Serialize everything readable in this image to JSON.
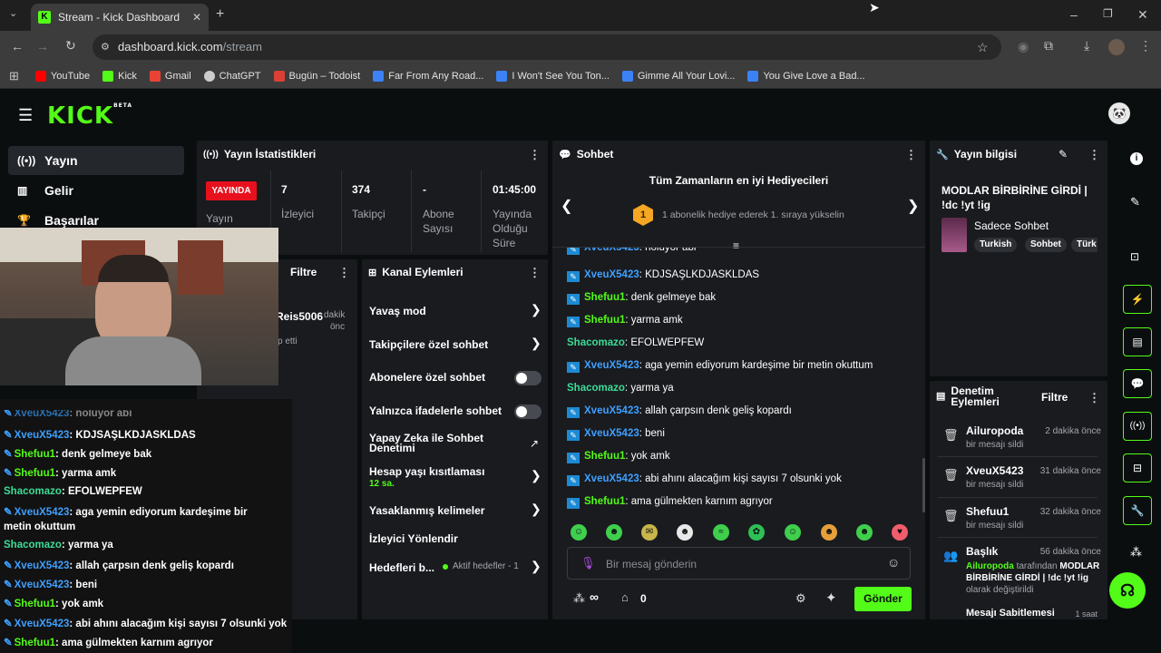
{
  "browser": {
    "tab_title": "Stream - Kick Dashboard",
    "url_domain": "dashboard.kick.com",
    "url_path": "/stream",
    "bookmarks": [
      {
        "label": "YouTube",
        "color": "#ff0000"
      },
      {
        "label": "Kick",
        "color": "#53fc18"
      },
      {
        "label": "Gmail",
        "color": "#ea4335"
      },
      {
        "label": "ChatGPT",
        "color": "#cccccc"
      },
      {
        "label": "Bugün – Todoist",
        "color": "#db4035"
      },
      {
        "label": "Far From Any Road...",
        "color": "#3b82f6"
      },
      {
        "label": "I Won't See You Ton...",
        "color": "#3b82f6"
      },
      {
        "label": "Gimme All Your Lovi...",
        "color": "#3b82f6"
      },
      {
        "label": "You Give Love a Bad...",
        "color": "#3b82f6"
      }
    ]
  },
  "brand": {
    "logo": "KICK",
    "beta": "BETA",
    "accent": "#53fc18"
  },
  "nav": {
    "items": [
      {
        "label": "Yayın",
        "icon": "broadcast-icon"
      },
      {
        "label": "Gelir",
        "icon": "chart-icon"
      },
      {
        "label": "Başarılar",
        "icon": "trophy-icon"
      }
    ]
  },
  "stats": {
    "title": "Yayın İstatistikleri",
    "live_badge": "YAYINDA",
    "live_label": "Yayın",
    "viewers_value": "7",
    "viewers_label": "İzleyici",
    "followers_value": "374",
    "followers_label": "Takipçi",
    "subs_value": "-",
    "subs_label": "Abone Sayısı",
    "duration_value": "01:45:00",
    "duration_label": "Yayında Olduğu Süre"
  },
  "activity": {
    "filter": "Filtre",
    "item_name": "Reis5006",
    "item_time1": "dakik",
    "item_time2": "önc",
    "item_sub": "p etti"
  },
  "channel_actions": {
    "title": "Kanal Eylemleri",
    "slow_mode": "Yavaş mod",
    "followers_only": "Takipçilere özel sohbet",
    "subs_only": "Abonelere özel sohbet",
    "emotes_only": "Yalnızca ifadelerle sohbet",
    "ai_moderation": "Yapay Zeka ile Sohbet Denetimi",
    "account_age": "Hesap yaşı kısıtlaması",
    "account_age_value": "12 sa.",
    "banned_words": "Yasaklanmış kelimeler",
    "redirect": "İzleyici Yönlendir",
    "goals": "Hedefleri b...",
    "goals_status": "Aktif hedefler - 1"
  },
  "chat": {
    "title": "Sohbet",
    "gifters_title": "Tüm Zamanların en iyi Hediyecileri",
    "gifters_rank": "1",
    "gifters_text": "1 abonelik hediye ederek 1. sıraya yükselin",
    "partial_msg": "noluyor abi",
    "messages": [
      {
        "user": "XveuX5423",
        "text": "KDJSAŞLKDJASKLDAS",
        "color": "blue",
        "badge": true
      },
      {
        "user": "Shefuu1",
        "text": "denk gelmeye bak",
        "color": "green",
        "badge": true
      },
      {
        "user": "Shefuu1",
        "text": "yarma amk",
        "color": "green",
        "badge": true
      },
      {
        "user": "Shacomazo",
        "text": "EFOLWEPFEW",
        "color": "teal",
        "badge": false
      },
      {
        "user": "XveuX5423",
        "text": "aga yemin ediyorum kardeşime bir metin okuttum",
        "color": "blue",
        "badge": true
      },
      {
        "user": "Shacomazo",
        "text": "yarma ya",
        "color": "teal",
        "badge": false
      },
      {
        "user": "XveuX5423",
        "text": "allah çarpsın denk geliş kopardı",
        "color": "blue",
        "badge": true
      },
      {
        "user": "XveuX5423",
        "text": "beni",
        "color": "blue",
        "badge": true
      },
      {
        "user": "Shefuu1",
        "text": "yok amk",
        "color": "green",
        "badge": true
      },
      {
        "user": "XveuX5423",
        "text": "abi ahını alacağım kişi sayısı 7 olsunki yok",
        "color": "blue",
        "badge": true
      },
      {
        "user": "Shefuu1",
        "text": "ama gülmekten karnım agrıyor",
        "color": "green",
        "badge": true
      }
    ],
    "input_placeholder": "Bir mesaj gönderin",
    "points": "∞",
    "gifts": "0",
    "send": "Gönder"
  },
  "overlay_chat": {
    "messages": [
      {
        "user": "XveuX5423",
        "text": "KDJSAŞLKDJASKLDAS",
        "color": "blue",
        "badge": true
      },
      {
        "user": "Shefuu1",
        "text": "denk gelmeye bak",
        "color": "green",
        "badge": true
      },
      {
        "user": "Shefuu1",
        "text": "yarma amk",
        "color": "green",
        "badge": true
      },
      {
        "user": "Shacomazo",
        "text": "EFOLWEPFEW",
        "color": "teal",
        "badge": false
      },
      {
        "user": "XveuX5423",
        "text": "aga yemin ediyorum kardeşime bir metin okuttum",
        "color": "blue",
        "badge": true
      },
      {
        "user": "Shacomazo",
        "text": "yarma ya",
        "color": "teal",
        "badge": false
      },
      {
        "user": "XveuX5423",
        "text": "allah çarpsın denk geliş kopardı",
        "color": "blue",
        "badge": true
      },
      {
        "user": "XveuX5423",
        "text": "beni",
        "color": "blue",
        "badge": true
      },
      {
        "user": "Shefuu1",
        "text": "yok amk",
        "color": "green",
        "badge": true
      },
      {
        "user": "XveuX5423",
        "text": "abi ahını alacağım kişi sayısı 7 olsunki yok",
        "color": "blue",
        "badge": true
      },
      {
        "user": "Shefuu1",
        "text": "ama gülmekten karnım agrıyor",
        "color": "green",
        "badge": true
      }
    ]
  },
  "stream_info": {
    "title_label": "Yayın bilgisi",
    "stream_title": "MODLAR BİRBİRİNE GİRDİ | !dc !yt !ig",
    "category": "Sadece Sohbet",
    "tags": [
      "Turkish",
      "Sohbet",
      "Türk"
    ]
  },
  "moderation": {
    "title": "Denetim Eylemleri",
    "filter": "Filtre",
    "items": [
      {
        "user": "Ailuropoda",
        "time": "2 dakika önce",
        "action": "bir mesajı sildi"
      },
      {
        "user": "XveuX5423",
        "time": "31 dakika önce",
        "action": "bir mesajı sildi"
      },
      {
        "user": "Shefuu1",
        "time": "32 dakika önce",
        "action": "bir mesajı sildi"
      }
    ],
    "title_change": {
      "label": "Başlık",
      "time": "56 dakika önce",
      "by": "Ailuropoda",
      "by_suffix": "tarafından",
      "new_title": "MODLAR BİRBİRİNE GİRDİ | !dc !yt !ig",
      "suffix": "olarak değiştirildi"
    },
    "next_item": "Mesajı Sabitlemesi",
    "next_time": "1 saat"
  }
}
